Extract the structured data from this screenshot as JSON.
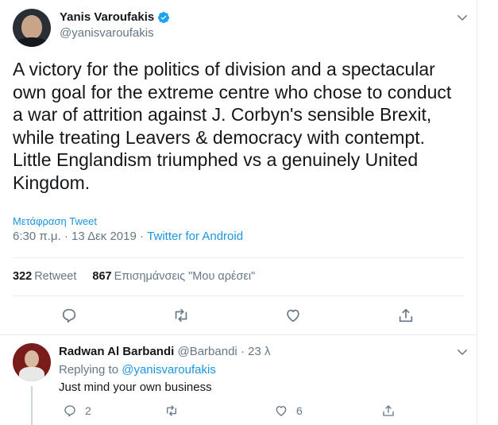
{
  "tweet": {
    "author_name": "Yanis Varoufakis",
    "author_handle": "@yanisvaroufakis",
    "text": "A victory for the politics of division and a spectacular own goal for the extreme centre who chose to conduct a war of attrition against J. Corbyn's sensible Brexit, while treating Leavers  & democracy with contempt. Little Englandism triumphed vs a genuinely United Kingdom.",
    "translate_label": "Μετάφραση Tweet",
    "time": "6:30 π.μ.",
    "sep1": "·",
    "date": "13 Δεκ 2019",
    "sep2": "·",
    "source": "Twitter for Android",
    "retweet_count": "322",
    "retweet_label": "Retweet",
    "like_count": "867",
    "like_label": "Επισημάνσεις \"Μου αρέσει\""
  },
  "reply": {
    "author_name": "Radwan Al Barbandi",
    "author_handle": "@Barbandi",
    "sep": "·",
    "age": "23 λ",
    "replying_prefix": "Replying to",
    "replying_handle": "@yanisvaroufakis",
    "text": "Just mind your own business",
    "reply_count": "2",
    "like_count": "6"
  },
  "colors": {
    "accent": "#1b95e0",
    "secondary_text": "#657786",
    "icon": "#657786",
    "verified": "#1da1f2"
  },
  "icons": [
    "verified-badge-icon",
    "chevron-down-icon",
    "reply-icon",
    "retweet-icon",
    "like-heart-icon",
    "share-icon"
  ]
}
